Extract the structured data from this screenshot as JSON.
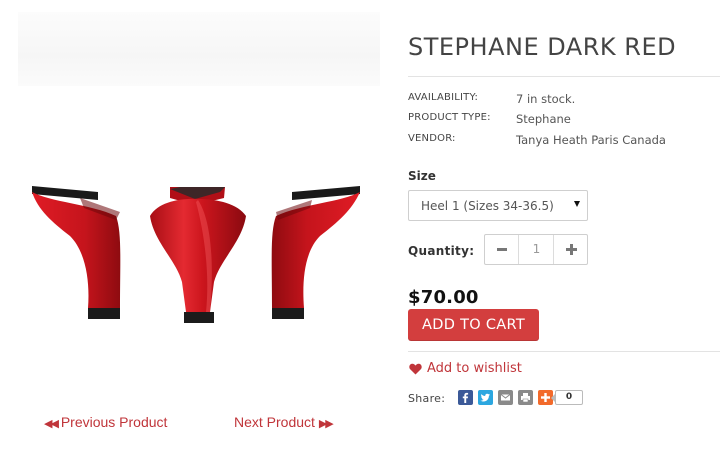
{
  "product": {
    "title": "STEPHANE DARK RED",
    "meta": [
      {
        "key": "AVAILABILITY:",
        "value": "7 in stock."
      },
      {
        "key": "PRODUCT TYPE:",
        "value": "Stephane"
      },
      {
        "key": "VENDOR:",
        "value": "Tanya Heath Paris Canada"
      }
    ],
    "size": {
      "label": "Size",
      "selected": "Heel 1 (Sizes 34-36.5)"
    },
    "quantity": {
      "label": "Quantity:",
      "value": "1"
    },
    "price": "$70.00",
    "add_to_cart_label": "ADD TO CART",
    "wishlist_label": "Add to wishlist"
  },
  "share": {
    "label": "Share:",
    "icons": [
      "facebook-icon",
      "twitter-icon",
      "email-icon",
      "print-icon",
      "addthis-plus-icon"
    ],
    "count": "0"
  },
  "pager": {
    "previous_label": "Previous Product",
    "next_label": "Next Product"
  },
  "colors": {
    "accent_red": "#d33e3e",
    "link_red": "#c0353a",
    "heel_red": "#c8141c"
  }
}
